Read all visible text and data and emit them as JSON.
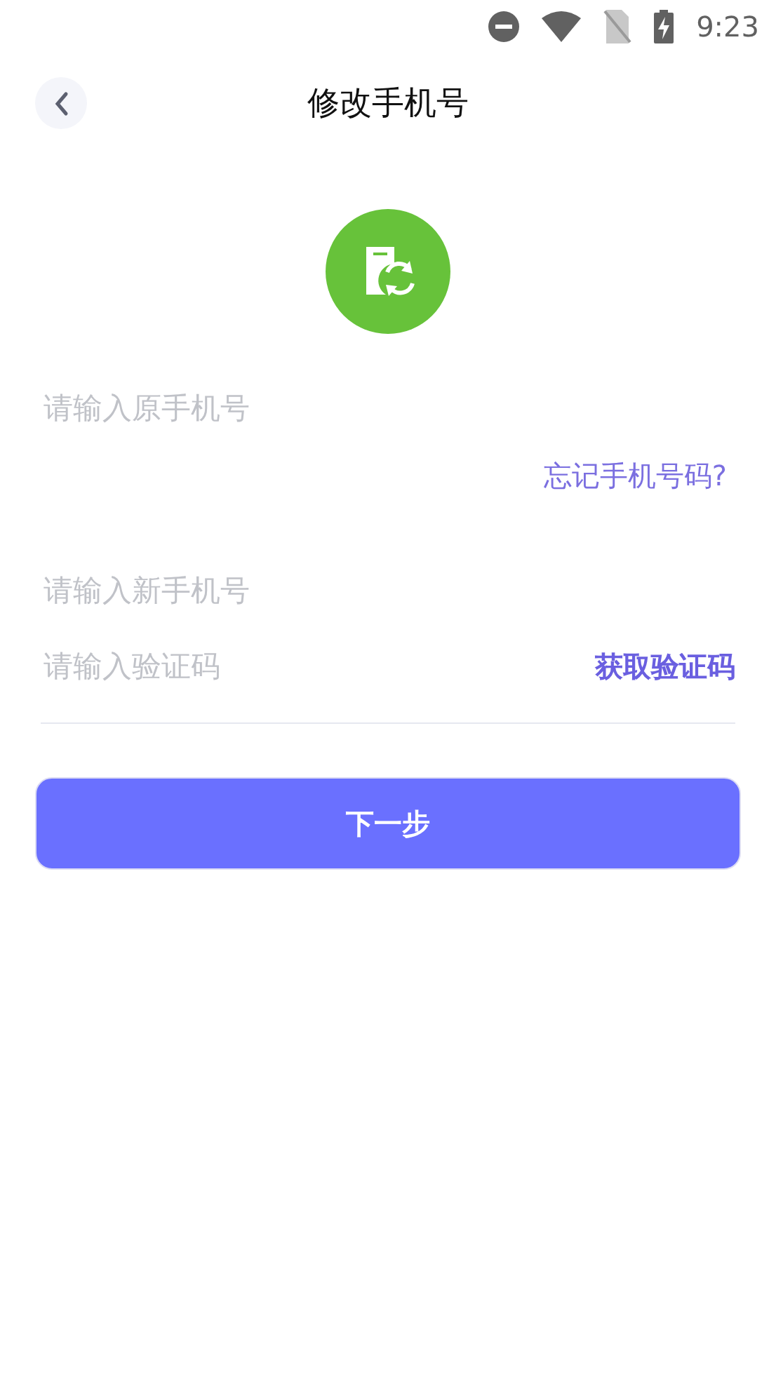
{
  "status_bar": {
    "time": "9:23"
  },
  "header": {
    "title": "修改手机号"
  },
  "old_phone": {
    "placeholder": "请输入原手机号"
  },
  "forgot_link": "忘记手机号码?",
  "fields": [
    {
      "kind": "text",
      "placeholder": "请输入新手机号"
    },
    {
      "kind": "code",
      "placeholder": "请输入验证码",
      "action": "获取验证码"
    }
  ],
  "submit_button": "下一步"
}
